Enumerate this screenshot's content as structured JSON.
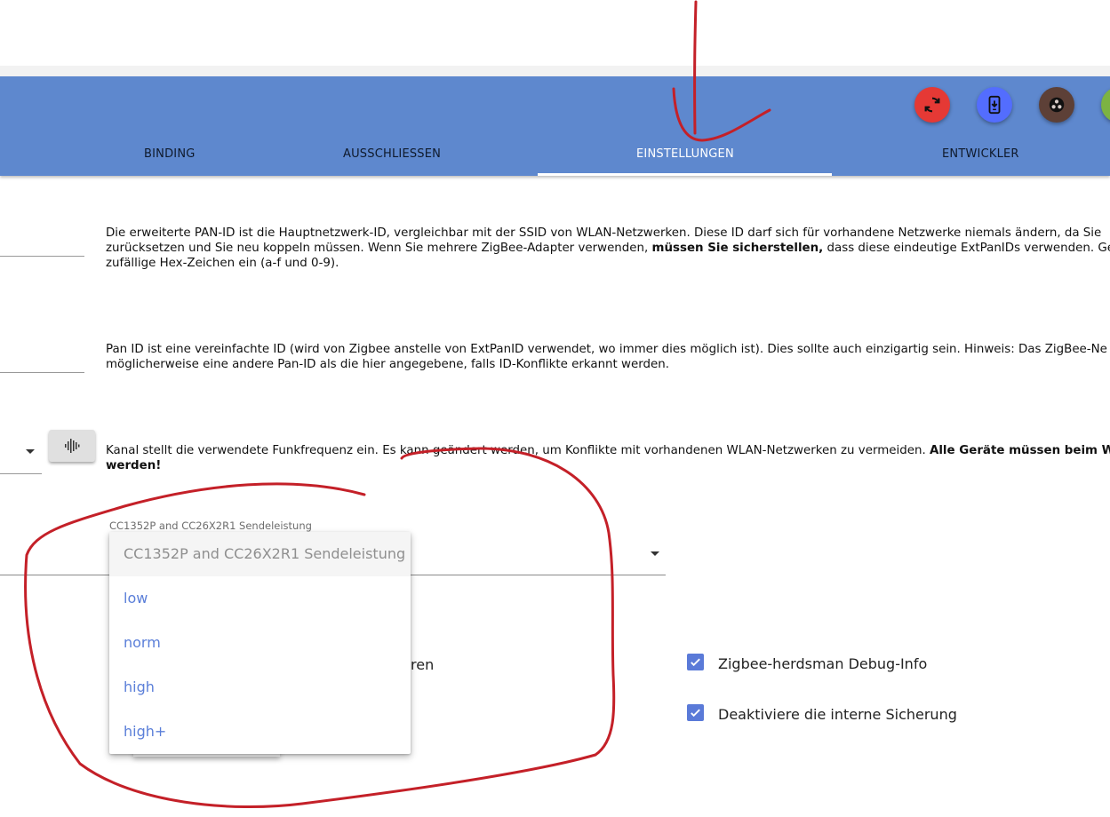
{
  "tabs": [
    {
      "label": "BINDING",
      "active": false
    },
    {
      "label": "AUSSCHLIESSEN",
      "active": false
    },
    {
      "label": "EINSTELLUNGEN",
      "active": true
    },
    {
      "label": "ENTWICKLER",
      "active": false
    }
  ],
  "header_buttons": [
    {
      "name": "refresh-button",
      "icon": "refresh-icon",
      "color": "#e53935"
    },
    {
      "name": "install-device-button",
      "icon": "phone-download-icon",
      "color": "#536dfe"
    },
    {
      "name": "adapter-button",
      "icon": "network-icon",
      "color": "#5d4037"
    },
    {
      "name": "extra-button",
      "icon": "circle-icon",
      "color": "#7cb342"
    }
  ],
  "descriptions": {
    "extpanid": {
      "line1": "Die erweiterte PAN-ID ist die Hauptnetzwerk-ID, vergleichbar mit der SSID von WLAN-Netzwerken. Diese ID darf sich für vorhandene Netzwerke niemals ändern, da Sie",
      "line2_a": "zurücksetzen und Sie neu koppeln müssen. Wenn Sie mehrere ZigBee-Adapter verwenden, ",
      "line2_b": "müssen Sie sicherstellen,",
      "line2_c": " dass diese eindeutige ExtPanIDs verwenden. Geb",
      "line3": "zufällige Hex-Zeichen ein (a-f und 0-9)."
    },
    "panid": {
      "line1": "Pan ID ist eine vereinfachte ID (wird von Zigbee anstelle von ExtPanID verwendet, wo immer dies möglich ist). Dies sollte auch einzigartig sein. Hinweis: Das ZigBee-Ne",
      "line2": "möglicherweise eine andere Pan-ID als die hier angegebene, falls ID-Konflikte erkannt werden."
    },
    "channel": {
      "line1_a": "Kanal stellt die verwendete Funkfrequenz ein. Es kann geändert werden, um Konflikte mit vorhandenen WLAN-Netzwerken zu vermeiden. ",
      "line1_b": "Alle Geräte müssen beim W",
      "line2_b": "werden!"
    }
  },
  "transmit_power": {
    "label": "CC1352P and CC26X2R1 Sendeleistung",
    "menu_header": "CC1352P and CC26X2R1 Sendeleistung",
    "options": [
      "low",
      "norm",
      "high",
      "high+"
    ]
  },
  "partial_label": "ren",
  "checkboxes": [
    {
      "label": "Zigbee-herdsman Debug-Info",
      "checked": true
    },
    {
      "label": "Deaktiviere die interne Sicherung",
      "checked": true
    }
  ],
  "colors": {
    "header": "#5e88ce",
    "accent": "#5a7ad8",
    "annotation": "#c42028"
  }
}
